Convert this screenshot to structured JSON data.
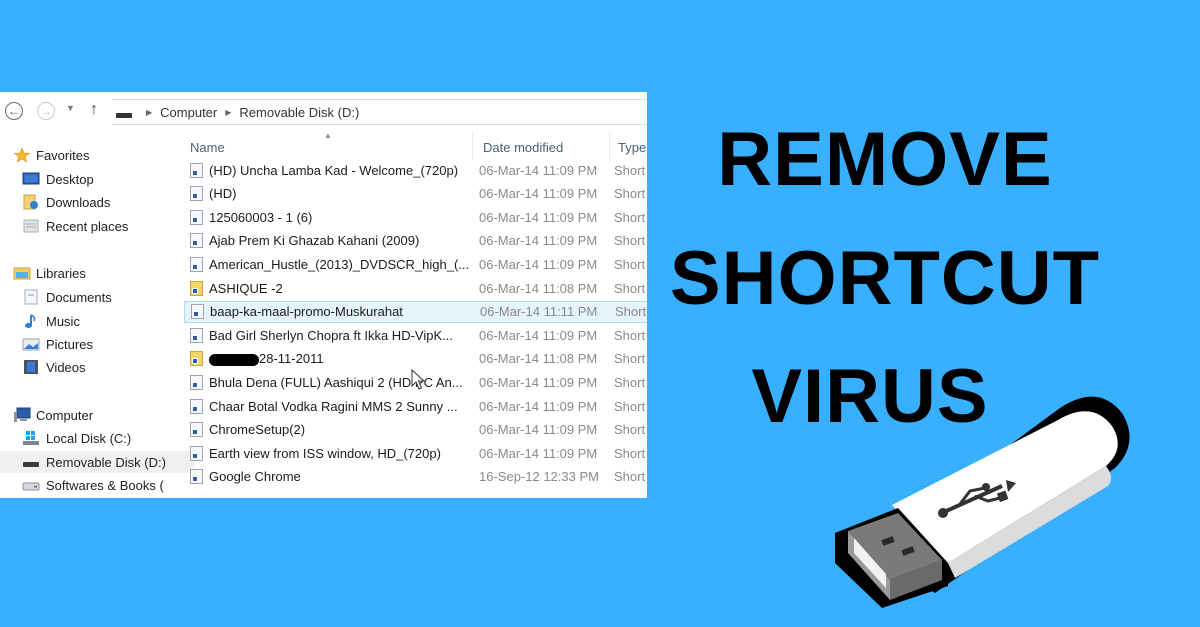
{
  "theme": {
    "background": "#38B0FF",
    "selected_row_bg": "#E5F3FB",
    "text_dark": "#000000"
  },
  "explorer": {
    "nav": {
      "back_icon": "back-arrow-icon",
      "forward_icon": "forward-arrow-icon",
      "recent_dropdown_icon": "chevron-down-icon",
      "up_icon": "up-arrow-icon",
      "breadcrumb": [
        "Computer",
        "Removable Disk (D:)"
      ]
    },
    "sidebar": {
      "groups": [
        {
          "label": "Favorites",
          "icon": "star-icon",
          "items": [
            {
              "label": "Desktop",
              "icon": "desktop-icon"
            },
            {
              "label": "Downloads",
              "icon": "downloads-icon"
            },
            {
              "label": "Recent places",
              "icon": "recent-places-icon"
            }
          ]
        },
        {
          "label": "Libraries",
          "icon": "libraries-icon",
          "items": [
            {
              "label": "Documents",
              "icon": "documents-icon"
            },
            {
              "label": "Music",
              "icon": "music-icon"
            },
            {
              "label": "Pictures",
              "icon": "pictures-icon"
            },
            {
              "label": "Videos",
              "icon": "videos-icon"
            }
          ]
        },
        {
          "label": "Computer",
          "icon": "computer-icon",
          "items": [
            {
              "label": "Local Disk (C:)",
              "icon": "local-disk-icon"
            },
            {
              "label": "Removable Disk (D:)",
              "icon": "removable-disk-icon",
              "active": true
            },
            {
              "label": "Softwares & Books (",
              "icon": "drive-icon"
            }
          ]
        }
      ]
    },
    "columns": {
      "name": "Name",
      "date_modified": "Date modified",
      "type": "Type"
    },
    "files": [
      {
        "name": "(HD) Uncha Lamba Kad - Welcome_(720p)",
        "date": "06-Mar-14 11:09 PM",
        "type": "Short",
        "icon": "shortcut-file-icon"
      },
      {
        "name": "(HD)",
        "date": "06-Mar-14 11:09 PM",
        "type": "Short",
        "icon": "shortcut-file-icon"
      },
      {
        "name": "125060003 - 1 (6)",
        "date": "06-Mar-14 11:09 PM",
        "type": "Short",
        "icon": "shortcut-file-icon"
      },
      {
        "name": "Ajab Prem Ki Ghazab Kahani (2009)",
        "date": "06-Mar-14 11:09 PM",
        "type": "Short",
        "icon": "shortcut-file-icon"
      },
      {
        "name": "American_Hustle_(2013)_DVDSCR_high_(...",
        "date": "06-Mar-14 11:09 PM",
        "type": "Short",
        "icon": "shortcut-file-icon"
      },
      {
        "name": "ASHIQUE -2",
        "date": "06-Mar-14 11:08 PM",
        "type": "Short",
        "icon": "shortcut-folder-icon"
      },
      {
        "name": "baap-ka-maal-promo-Muskurahat",
        "date": "06-Mar-14 11:11 PM",
        "type": "Short",
        "icon": "shortcut-file-icon",
        "selected": true
      },
      {
        "name": "Bad Girl Sherlyn Chopra ft Ikka HD-VipK...",
        "date": "06-Mar-14 11:09 PM",
        "type": "Short",
        "icon": "shortcut-file-icon"
      },
      {
        "name": "28-11-2011",
        "date": "06-Mar-14 11:08 PM",
        "type": "Short",
        "icon": "shortcut-folder-icon",
        "redacted_prefix": true
      },
      {
        "name": "Bhula Dena (FULL) Aashiqui 2 (HD PC An...",
        "date": "06-Mar-14 11:09 PM",
        "type": "Short",
        "icon": "shortcut-file-icon"
      },
      {
        "name": "Chaar Botal Vodka Ragini MMS 2 Sunny ...",
        "date": "06-Mar-14 11:09 PM",
        "type": "Short",
        "icon": "shortcut-file-icon"
      },
      {
        "name": "ChromeSetup(2)",
        "date": "06-Mar-14 11:09 PM",
        "type": "Short",
        "icon": "shortcut-file-icon"
      },
      {
        "name": "Earth view from ISS window, HD_(720p)",
        "date": "06-Mar-14 11:09 PM",
        "type": "Short",
        "icon": "shortcut-file-icon"
      },
      {
        "name": "Google Chrome",
        "date": "16-Sep-12 12:33 PM",
        "type": "Short",
        "icon": "shortcut-file-icon"
      }
    ]
  },
  "headline": {
    "lines": [
      "REMOVE",
      "SHORTCUT",
      "VIRUS"
    ]
  },
  "illustration": {
    "icon": "usb-flash-drive-icon"
  }
}
